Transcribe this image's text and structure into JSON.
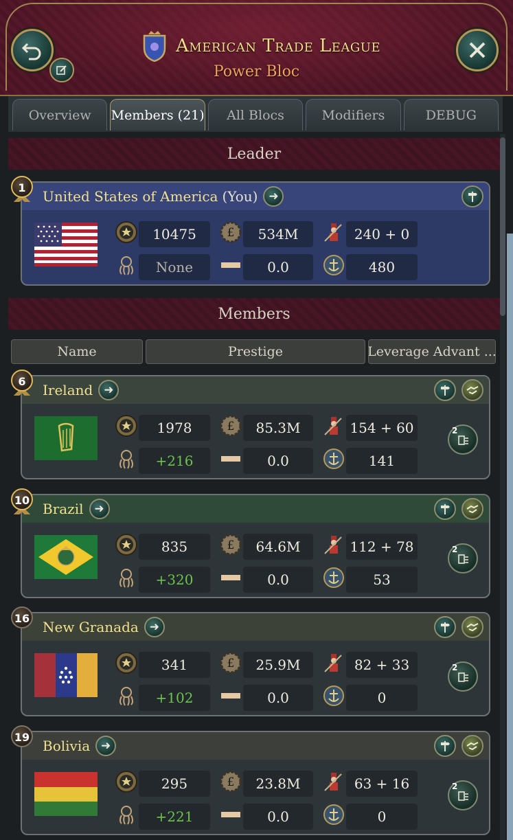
{
  "header": {
    "title": "American Trade League",
    "subtitle": "Power Bloc"
  },
  "tabs": [
    {
      "label": "Overview"
    },
    {
      "label": "Members (21)"
    },
    {
      "label": "All Blocs"
    },
    {
      "label": "Modifiers"
    },
    {
      "label": "DEBUG"
    }
  ],
  "sections": {
    "leader": "Leader",
    "members": "Members"
  },
  "columns": {
    "name": "Name",
    "prestige": "Prestige",
    "leverage": "Leverage Advant ..."
  },
  "leader": {
    "rank": "1",
    "name": "United States of America",
    "you": "(You)",
    "prestige": "10475",
    "gdp": "534M",
    "army": "240 + 0",
    "leverage": "None",
    "trade": "0.0",
    "navy": "480"
  },
  "members": [
    {
      "rank": "6",
      "name": "Ireland",
      "prestige": "1978",
      "gdp": "85.3M",
      "army": "154 + 60",
      "leverage": "+216",
      "trade": "0.0",
      "navy": "141",
      "objective_count": "2"
    },
    {
      "rank": "10",
      "name": "Brazil",
      "prestige": "835",
      "gdp": "64.6M",
      "army": "112 + 78",
      "leverage": "+320",
      "trade": "0.0",
      "navy": "53",
      "objective_count": "2"
    },
    {
      "rank": "16",
      "name": "New Granada",
      "prestige": "341",
      "gdp": "25.9M",
      "army": "82 + 33",
      "leverage": "+102",
      "trade": "0.0",
      "navy": "0",
      "objective_count": "2"
    },
    {
      "rank": "19",
      "name": "Bolivia",
      "prestige": "295",
      "gdp": "23.8M",
      "army": "63 + 16",
      "leverage": "+221",
      "trade": "0.0",
      "navy": "0",
      "objective_count": "2"
    }
  ],
  "colors": {
    "header_bg": "#4a1424",
    "title_gold": "#f3df8a",
    "subtitle_orange": "#f0a35c",
    "leader_blue": "#2d3a66",
    "positive_green": "#6cc44f"
  }
}
